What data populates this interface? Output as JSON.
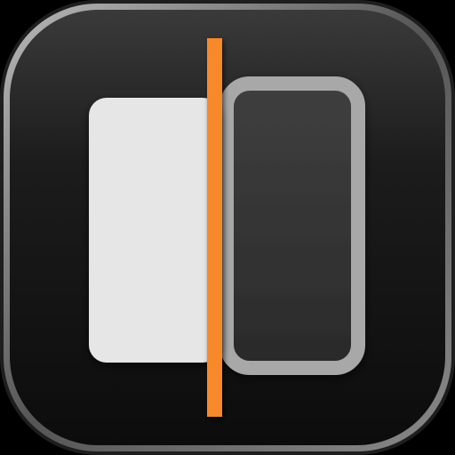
{
  "icon": {
    "symbol": "split-compare-icon",
    "colors": {
      "background": "#000000",
      "bezel_outer": "#1e1e1e",
      "bezel_rim": "#b9b9b9",
      "face_top": "#3a3a3a",
      "face_bottom": "#0c0c0c",
      "card_light": "#e6e6e6",
      "card_dark_fill": "#3f3f3f",
      "card_dark_border": "#a8a8a8",
      "divider": "#f7892b"
    }
  }
}
